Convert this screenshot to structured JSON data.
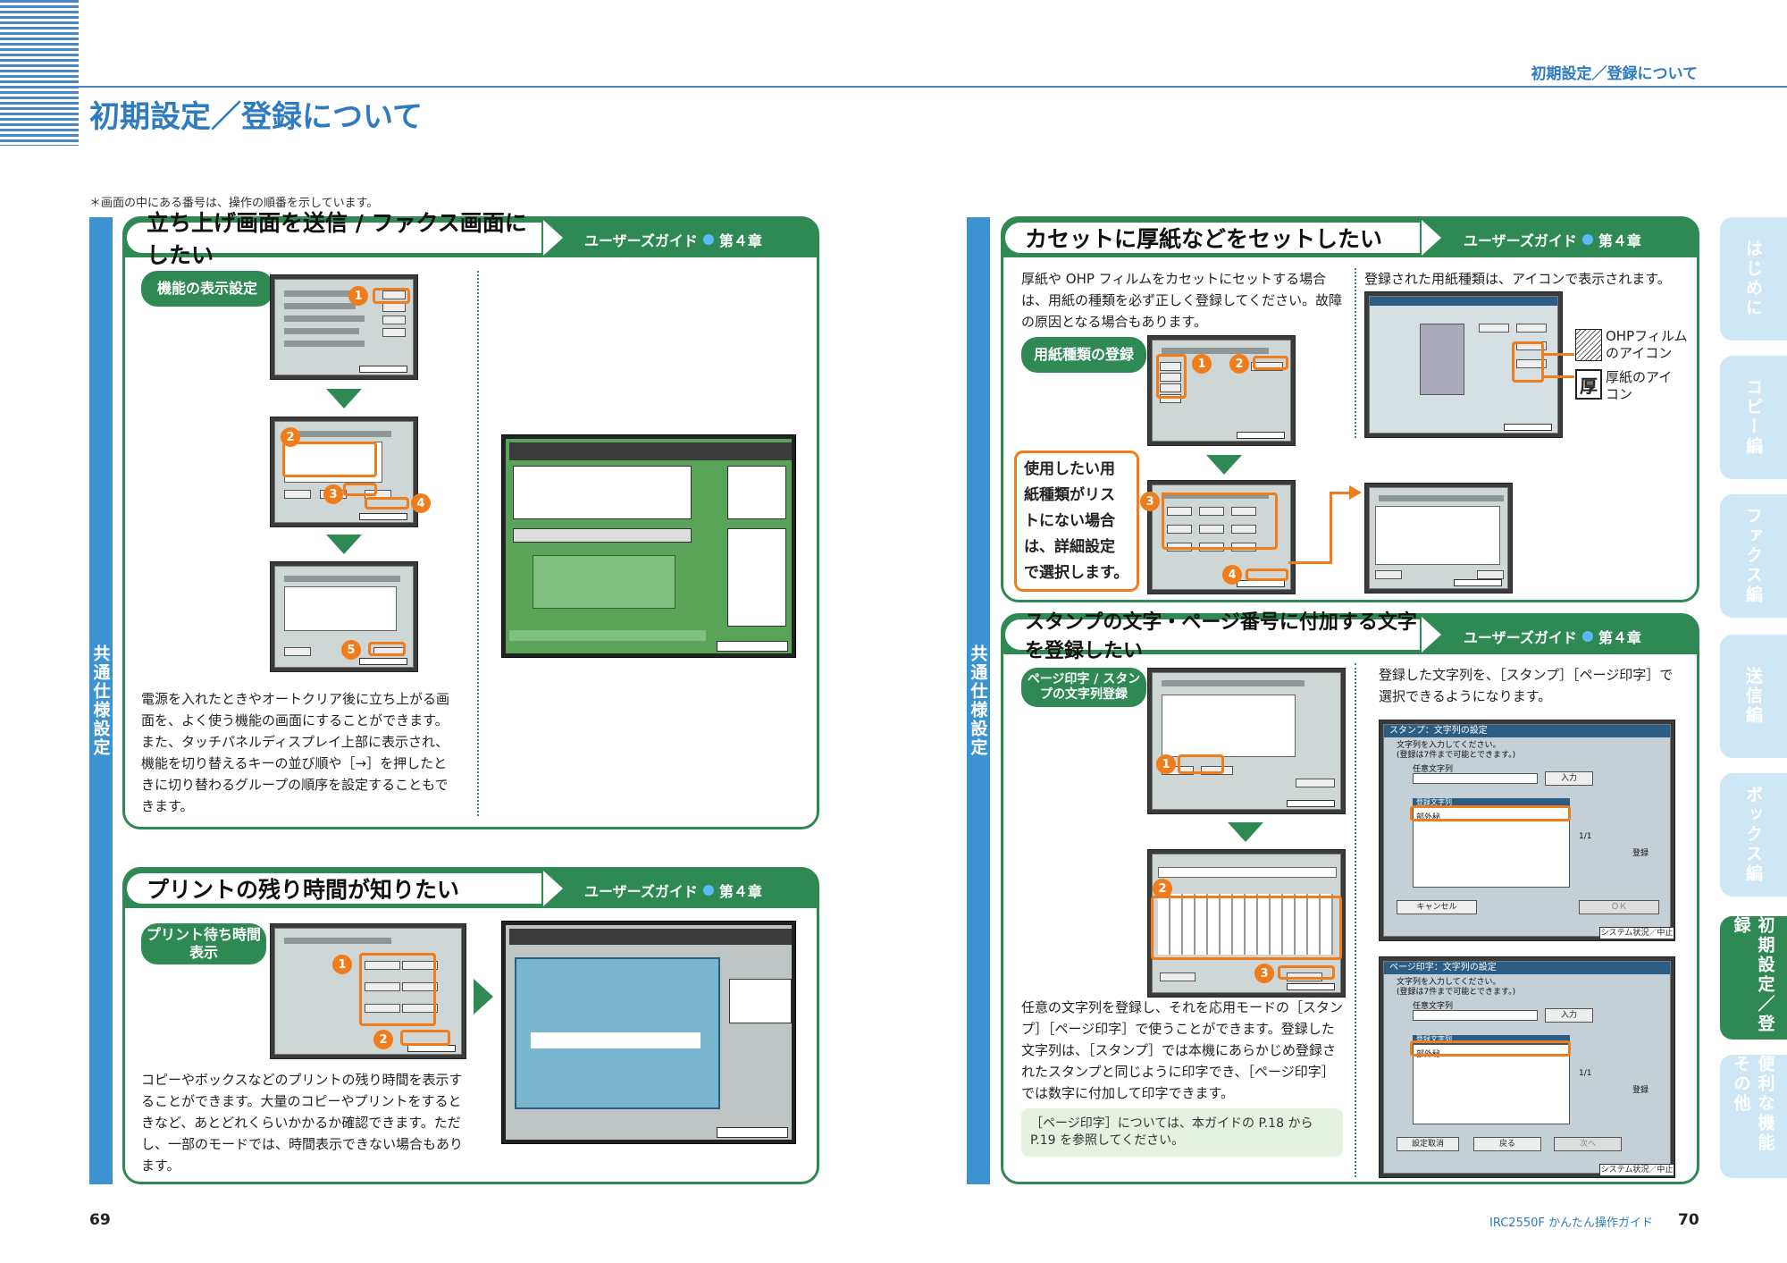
{
  "header": {
    "page_title": "初期設定／登録について",
    "running_head": "初期設定／登録について",
    "note": "＊画面の中にある番号は、操作の順番を示しています。"
  },
  "side_label": "共通仕様設定",
  "guide": {
    "label": "ユーザーズガイド",
    "chapter": "第４章"
  },
  "sec1": {
    "title": "立ち上げ画面を送信 / ファクス画面にしたい",
    "step_label": "機能の表示設定",
    "body": "電源を入れたときやオートクリア後に立ち上がる画面を、よく使う機能の画面にすることができます。また、タッチパネルディスプレイ上部に表示され、機能を切り替えるキーの並び順や［→］を押したときに切り替わるグループの順序を設定することもできます。",
    "steps": [
      "1",
      "2",
      "3",
      "4",
      "5"
    ]
  },
  "sec2": {
    "title": "プリントの残り時間が知りたい",
    "step_label": "プリント待ち時間表示",
    "body": "コピーやボックスなどのプリントの残り時間を表示することができます。大量のコピーやプリントをするときなど、あとどれくらいかかるか確認できます。ただし、一部のモードでは、時間表示できない場合もあります。",
    "steps": [
      "1",
      "2"
    ]
  },
  "sec3": {
    "title": "カセットに厚紙などをセットしたい",
    "step_label": "用紙種類の登録",
    "body": "厚紙や OHP フィルムをカセットにセットする場合は、用紙の種類を必ず正しく登録してください。故障の原因となる場合もあります。",
    "right_text": "登録された用紙種類は、アイコンで表示されます。",
    "icon_ohp": "OHPフィルムのアイコン",
    "icon_thick": "厚紙のアイコン",
    "thick_glyph": "厚",
    "callout": "使用したい用紙種類がリストにない場合は、詳細設定で選択します。",
    "steps": [
      "1",
      "2",
      "3",
      "4"
    ]
  },
  "sec4": {
    "title": "スタンプの文字・ページ番号に付加する文字を登録したい",
    "step_label": "ページ印字 / スタンプの文字列登録",
    "right_text": "登録した文字列を、［スタンプ］［ページ印字］で選択できるようになります。",
    "body": "任意の文字列を登録し、それを応用モードの［スタンプ］［ページ印字］で使うことができます。登録した文字列は、［スタンプ］では本機にあらかじめ登録されたスタンプと同じように印字でき、［ページ印字］では数字に付加して印字できます。",
    "reference": "［ページ印字］については、本ガイドの P.18 から P.19 を参照してください。",
    "steps": [
      "1",
      "2",
      "3"
    ],
    "stamp_screen": {
      "title": "スタンプ：文字列の設定",
      "msg1": "文字列を入力してください。",
      "msg2": "(登録は7件まで可能とできます。)",
      "field": "任意文字列",
      "input_btn": "入力",
      "list_head": "登録文字列",
      "item": "部外秘",
      "page": "1/1",
      "del": "登録",
      "cancel": "キャンセル",
      "ok": "ＯＫ",
      "status": "システム状況／中止"
    },
    "page_screen": {
      "title": "ページ印字：文字列の設定",
      "msg1": "文字列を入力してください。",
      "msg2": "(登録は7件まで可能とできます。)",
      "field": "任意文字列",
      "input_btn": "入力",
      "list_head": "登録文字列",
      "item": "部外秘",
      "page": "1/1",
      "del": "登録",
      "back": "設定取消",
      "prev": "戻る",
      "next": "次へ",
      "status": "システム状況／中止"
    }
  },
  "tabs": [
    "はじめに",
    "コピー編",
    "ファクス編",
    "送信編",
    "ボックス編",
    "初期設定／登録",
    "便利な機能 その他"
  ],
  "footer": {
    "left_page": "69",
    "right_page": "70",
    "product": "IRC2550F かんたん操作ガイド"
  }
}
